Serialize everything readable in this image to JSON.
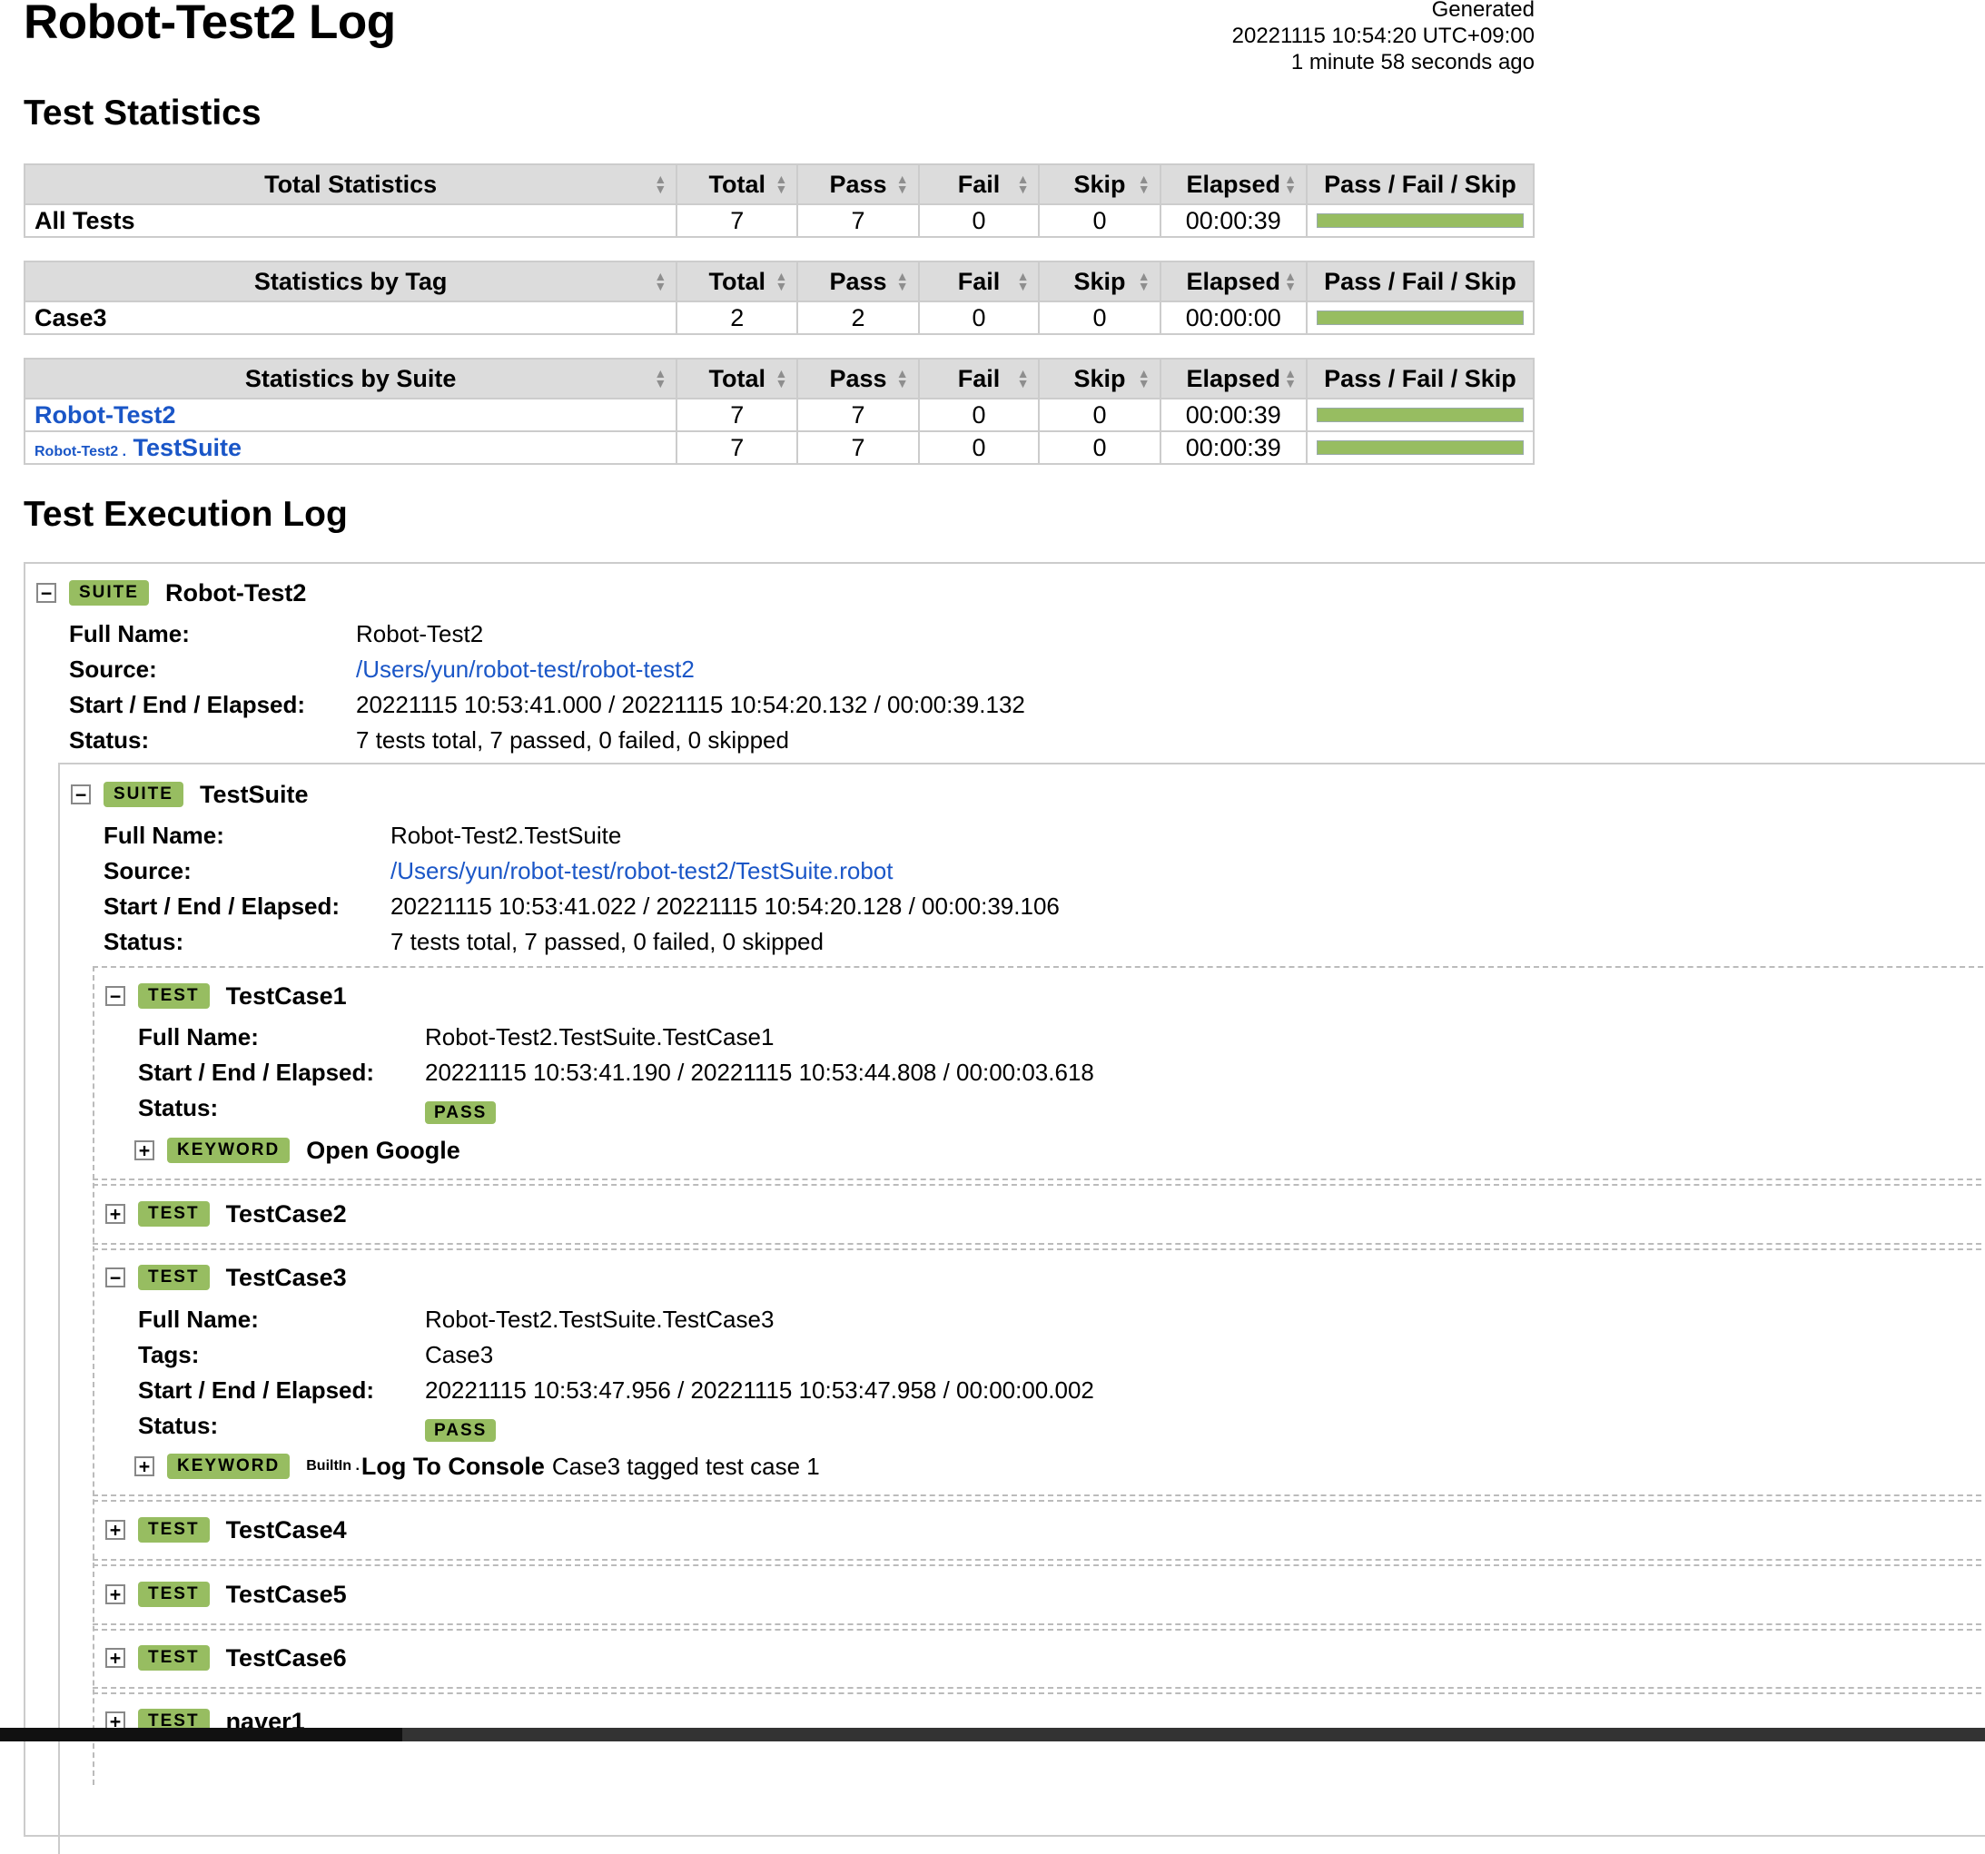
{
  "header": {
    "title": "Robot-Test2 Log",
    "generated_label": "Generated",
    "generated_time": "20221115 10:54:20 UTC+09:00",
    "generated_ago": "1 minute 58 seconds ago"
  },
  "statistics": {
    "heading": "Test Statistics",
    "columns": [
      "Total",
      "Pass",
      "Fail",
      "Skip",
      "Elapsed",
      "Pass / Fail / Skip"
    ],
    "total": {
      "title": "Total Statistics",
      "rows": [
        {
          "name": "All Tests",
          "total": "7",
          "pass": "7",
          "fail": "0",
          "skip": "0",
          "elapsed": "00:00:39",
          "pass_fraction": 1.0
        }
      ]
    },
    "tag": {
      "title": "Statistics by Tag",
      "rows": [
        {
          "name": "Case3",
          "total": "2",
          "pass": "2",
          "fail": "0",
          "skip": "0",
          "elapsed": "00:00:00",
          "pass_fraction": 1.0
        }
      ]
    },
    "suite": {
      "title": "Statistics by Suite",
      "rows": [
        {
          "name": "Robot-Test2",
          "parent": "",
          "total": "7",
          "pass": "7",
          "fail": "0",
          "skip": "0",
          "elapsed": "00:00:39",
          "pass_fraction": 1.0
        },
        {
          "name": "TestSuite",
          "parent": "Robot-Test2 .",
          "total": "7",
          "pass": "7",
          "fail": "0",
          "skip": "0",
          "elapsed": "00:00:39",
          "pass_fraction": 1.0
        }
      ]
    }
  },
  "log": {
    "heading": "Test Execution Log",
    "labels": {
      "full_name": "Full Name:",
      "source": "Source:",
      "start_end": "Start / End / Elapsed:",
      "status": "Status:",
      "tags": "Tags:"
    },
    "badges": {
      "suite": "SUITE",
      "test": "TEST",
      "keyword": "KEYWORD",
      "pass": "PASS"
    },
    "suite1": {
      "name": "Robot-Test2",
      "full_name": "Robot-Test2",
      "source": "/Users/yun/robot-test/robot-test2",
      "start_end": "20221115 10:53:41.000 / 20221115 10:54:20.132 / 00:00:39.132",
      "status": "7 tests total, 7 passed, 0 failed, 0 skipped"
    },
    "suite2": {
      "name": "TestSuite",
      "full_name": "Robot-Test2.TestSuite",
      "source": "/Users/yun/robot-test/robot-test2/TestSuite.robot",
      "start_end": "20221115 10:53:41.022 / 20221115 10:54:20.128 / 00:00:39.106",
      "status": "7 tests total, 7 passed, 0 failed, 0 skipped"
    },
    "test1": {
      "name": "TestCase1",
      "full_name": "Robot-Test2.TestSuite.TestCase1",
      "start_end": "20221115 10:53:41.190 / 20221115 10:53:44.808 / 00:00:03.618",
      "keyword": "Open Google"
    },
    "test2": {
      "name": "TestCase2"
    },
    "test3": {
      "name": "TestCase3",
      "full_name": "Robot-Test2.TestSuite.TestCase3",
      "tags": "Case3",
      "start_end": "20221115 10:53:47.956 / 20221115 10:53:47.958 / 00:00:00.002",
      "keyword_lib": "BuiltIn .",
      "keyword": "Log To Console",
      "keyword_args": "Case3 tagged test case 1"
    },
    "test4": {
      "name": "TestCase4"
    },
    "test5": {
      "name": "TestCase5"
    },
    "test6": {
      "name": "TestCase6"
    },
    "test7": {
      "name": "naver1"
    }
  },
  "colors": {
    "pass": "#97bd61",
    "link": "#1a56c7",
    "header_bg": "#dcdcdc"
  }
}
